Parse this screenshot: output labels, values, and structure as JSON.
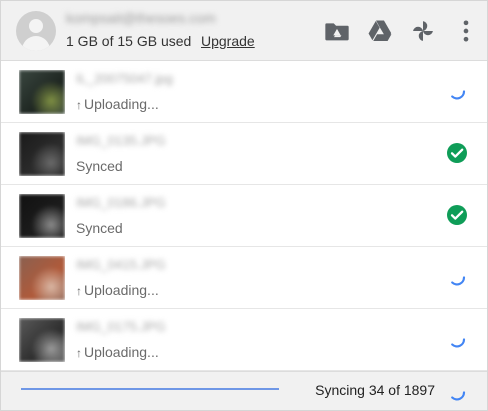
{
  "header": {
    "email": "kompsait@thesoes.com",
    "quota_text": "1 GB of 15 GB used",
    "upgrade_label": "Upgrade",
    "icons": [
      "drive-folder-icon",
      "google-drive-icon",
      "google-photos-icon",
      "more-vert-icon"
    ]
  },
  "files": [
    {
      "name": "IL_20075047.jpg",
      "status": "Uploading...",
      "state": "uploading",
      "thumb_colors": [
        "#3a4740",
        "#1e2621",
        "#7e8f43"
      ]
    },
    {
      "name": "IMG_0135.JPG",
      "status": "Synced",
      "state": "synced",
      "thumb_colors": [
        "#1a1a1a",
        "#2c2c2c",
        "#6a6a6a"
      ]
    },
    {
      "name": "IMG_0186.JPG",
      "status": "Synced",
      "state": "synced",
      "thumb_colors": [
        "#111111",
        "#1c1c1c",
        "#8a8a8a"
      ]
    },
    {
      "name": "IMG_0415.JPG",
      "status": "Uploading...",
      "state": "uploading",
      "thumb_colors": [
        "#8a6050",
        "#b05a3a",
        "#d9b6a3"
      ]
    },
    {
      "name": "IMG_0175.JPG",
      "status": "Uploading...",
      "state": "uploading",
      "thumb_colors": [
        "#5a5a5a",
        "#2e2e2e",
        "#9a9a9a"
      ]
    }
  ],
  "footer": {
    "sync_text": "Syncing 34 of 1897",
    "progress_fraction": 1.0
  },
  "colors": {
    "accent": "#4285f4",
    "synced_green": "#0f9d58",
    "icon_gray": "#5f6368"
  }
}
